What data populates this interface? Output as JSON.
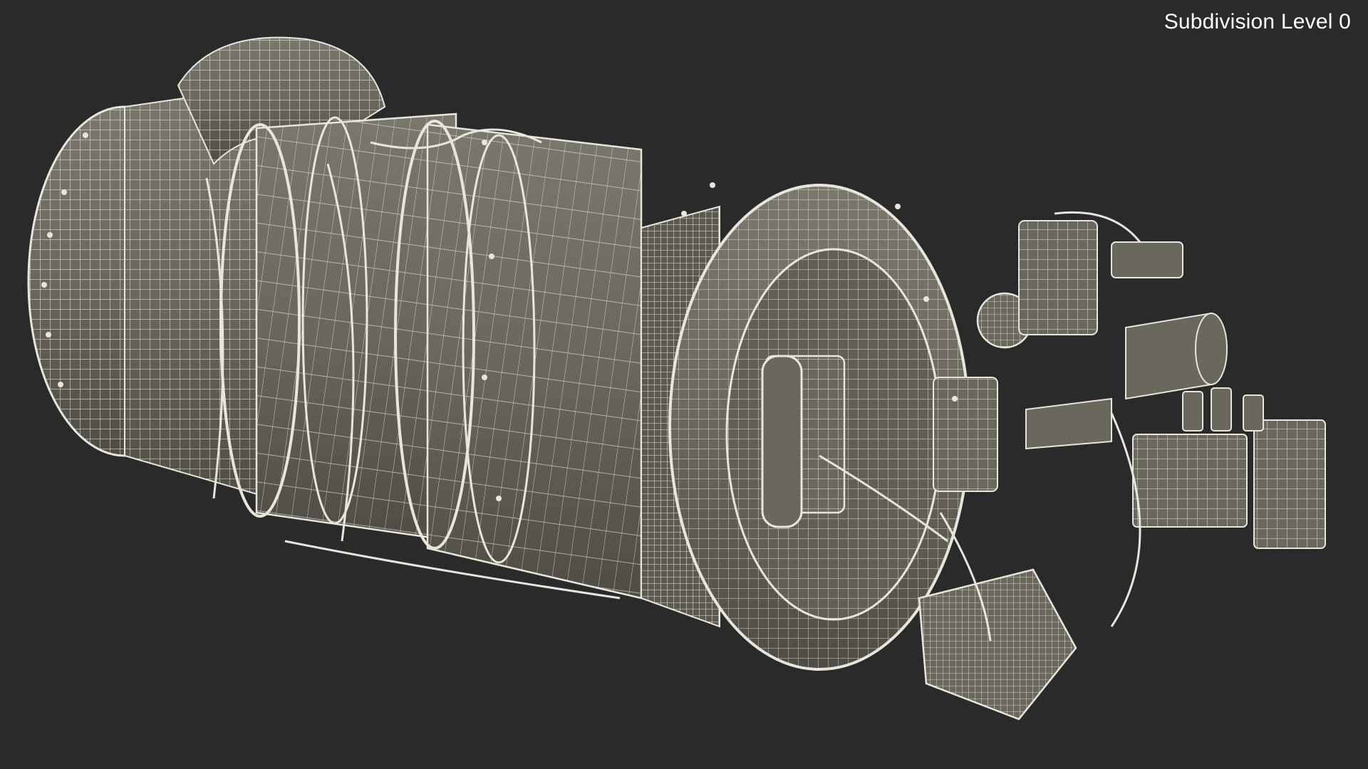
{
  "viewport": {
    "overlay_label": "Subdivision Level 0",
    "background_color": "#2a2a2a",
    "model_fill_color": "#6f6d62",
    "wire_color": "#e8e6da"
  },
  "model": {
    "icon": "turboshaft-engine-wireframe"
  }
}
